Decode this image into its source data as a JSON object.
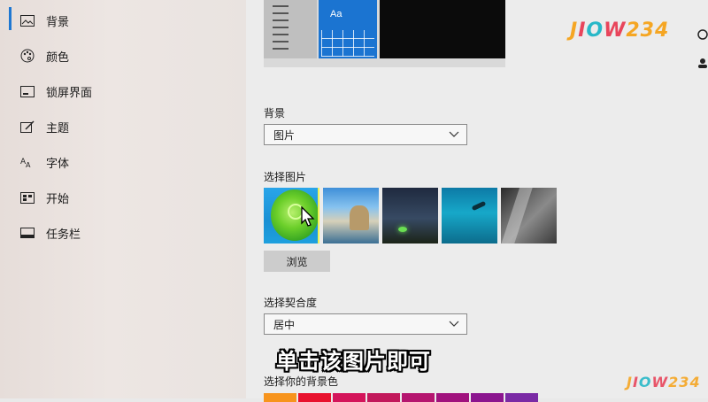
{
  "sidebar": {
    "items": [
      {
        "label": "背景",
        "icon": "image-icon"
      },
      {
        "label": "颜色",
        "icon": "palette-icon"
      },
      {
        "label": "锁屏界面",
        "icon": "lockscreen-icon"
      },
      {
        "label": "主题",
        "icon": "brush-icon"
      },
      {
        "label": "字体",
        "icon": "font-icon"
      },
      {
        "label": "开始",
        "icon": "start-icon"
      },
      {
        "label": "任务栏",
        "icon": "taskbar-icon"
      }
    ],
    "selected": "背景"
  },
  "preview": {
    "tile_text": "Aa"
  },
  "background": {
    "label": "背景",
    "value": "图片"
  },
  "choose_picture": {
    "label": "选择图片",
    "browse_label": "浏览"
  },
  "fit": {
    "label": "选择契合度",
    "value": "居中"
  },
  "bg_color": {
    "label": "选择你的背景色",
    "colors": [
      "#f7941d",
      "#e8112d",
      "#d4145a",
      "#c2185b",
      "#b5156f",
      "#a0127d",
      "#8b158f",
      "#7a2aa5"
    ]
  },
  "overlay": {
    "subtitle": "单击该图片即可",
    "watermark_top": [
      "J",
      "I",
      "O",
      "W",
      "234"
    ],
    "watermark_bottom": [
      "J",
      "I",
      "O",
      "W",
      "234"
    ]
  },
  "colors": {
    "accent": "#1e77d2"
  }
}
